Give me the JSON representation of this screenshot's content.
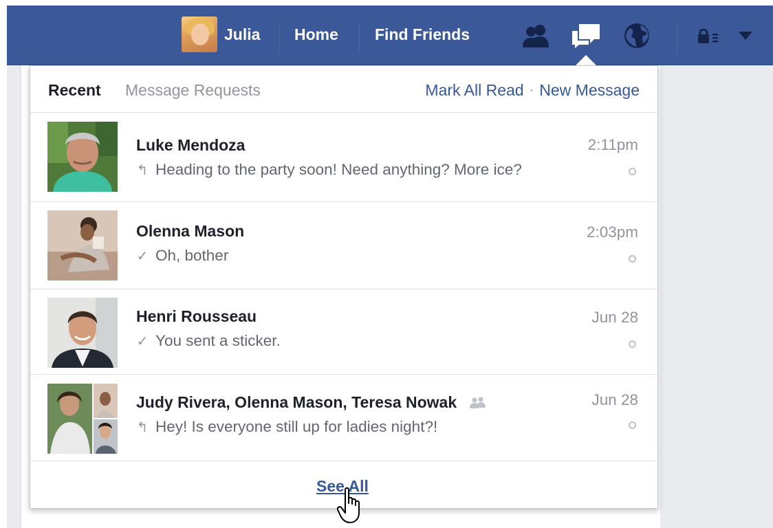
{
  "topbar": {
    "user_name": "Julia",
    "home_label": "Home",
    "find_friends_label": "Find Friends",
    "icons": [
      "friend-requests-icon",
      "messages-icon",
      "notifications-globe-icon",
      "privacy-lock-icon",
      "account-menu-caret-icon"
    ]
  },
  "messages_panel": {
    "tab_recent": "Recent",
    "tab_requests": "Message Requests",
    "mark_all_read": "Mark All Read",
    "separator": "·",
    "new_message": "New Message",
    "threads": [
      {
        "name": "Luke Mendoza",
        "snippet": "Heading to the party soon! Need anything? More ice?",
        "status_icon": "reply-arrow-icon",
        "time": "2:11pm"
      },
      {
        "name": "Olenna Mason",
        "snippet": "Oh, bother",
        "status_icon": "check-icon",
        "time": "2:03pm"
      },
      {
        "name": "Henri Rousseau",
        "snippet": "You sent a sticker.",
        "status_icon": "check-icon",
        "time": "Jun 28"
      },
      {
        "name": "Judy Rivera, Olenna Mason, Teresa Nowak",
        "snippet": "Hey! Is everyone still up for ladies night?!",
        "status_icon": "reply-arrow-icon",
        "group_icon": "group-icon",
        "time": "Jun 28"
      }
    ],
    "see_all": "See All"
  },
  "colors": {
    "topbar_bg": "#3b5998",
    "link": "#365899",
    "muted": "#90949c"
  }
}
